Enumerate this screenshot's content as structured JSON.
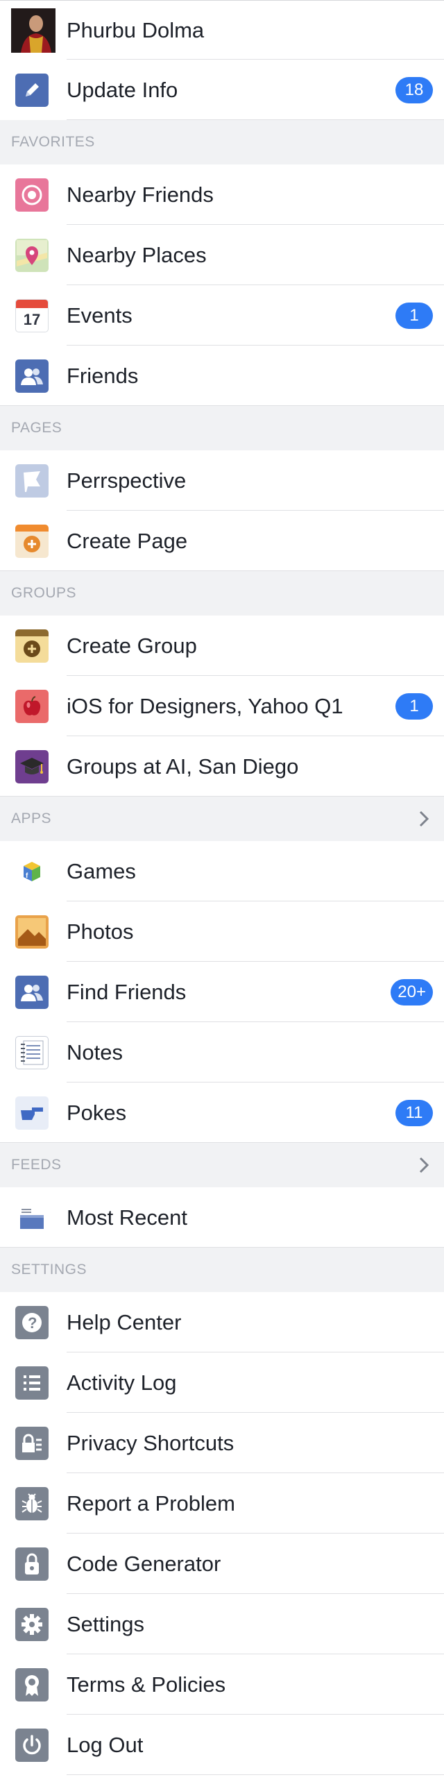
{
  "profile": {
    "name": "Phurbu Dolma"
  },
  "update_info": {
    "label": "Update Info",
    "badge": "18"
  },
  "sections": {
    "favorites": "FAVORITES",
    "pages": "PAGES",
    "groups": "GROUPS",
    "apps": "APPS",
    "feeds": "FEEDS",
    "settings": "SETTINGS"
  },
  "favorites": [
    {
      "label": "Nearby Friends",
      "icon": "nearby-friends-icon"
    },
    {
      "label": "Nearby Places",
      "icon": "map-pin-icon"
    },
    {
      "label": "Events",
      "icon": "calendar-icon",
      "icon_text": "17",
      "badge": "1"
    },
    {
      "label": "Friends",
      "icon": "friends-icon"
    }
  ],
  "pages": [
    {
      "label": "Perrspective",
      "icon": "flag-icon"
    },
    {
      "label": "Create Page",
      "icon": "create-page-icon"
    }
  ],
  "groups": [
    {
      "label": "Create Group",
      "icon": "create-group-icon"
    },
    {
      "label": "iOS for Designers, Yahoo Q1",
      "icon": "apple-icon",
      "badge": "1"
    },
    {
      "label": "Groups at AI, San Diego",
      "icon": "graduation-cap-icon"
    }
  ],
  "apps": [
    {
      "label": "Games",
      "icon": "games-icon"
    },
    {
      "label": "Photos",
      "icon": "photos-icon"
    },
    {
      "label": "Find Friends",
      "icon": "find-friends-icon",
      "badge": "20+"
    },
    {
      "label": "Notes",
      "icon": "notes-icon"
    },
    {
      "label": "Pokes",
      "icon": "poke-icon",
      "badge": "11"
    }
  ],
  "feeds": [
    {
      "label": "Most Recent",
      "icon": "news-feed-icon"
    }
  ],
  "settings": [
    {
      "label": "Help Center",
      "icon": "help-icon"
    },
    {
      "label": "Activity Log",
      "icon": "list-icon"
    },
    {
      "label": "Privacy Shortcuts",
      "icon": "lock-icon"
    },
    {
      "label": "Report a Problem",
      "icon": "bug-icon"
    },
    {
      "label": "Code Generator",
      "icon": "code-generator-icon"
    },
    {
      "label": "Settings",
      "icon": "gear-icon"
    },
    {
      "label": "Terms & Policies",
      "icon": "badge-icon"
    },
    {
      "label": "Log Out",
      "icon": "power-icon"
    }
  ],
  "colors": {
    "badge": "#2e7bf6",
    "section_bg": "#f1f2f4",
    "section_text": "#a4a8b1",
    "icon_blue": "#4d6db3",
    "icon_gray": "#7b8390"
  }
}
